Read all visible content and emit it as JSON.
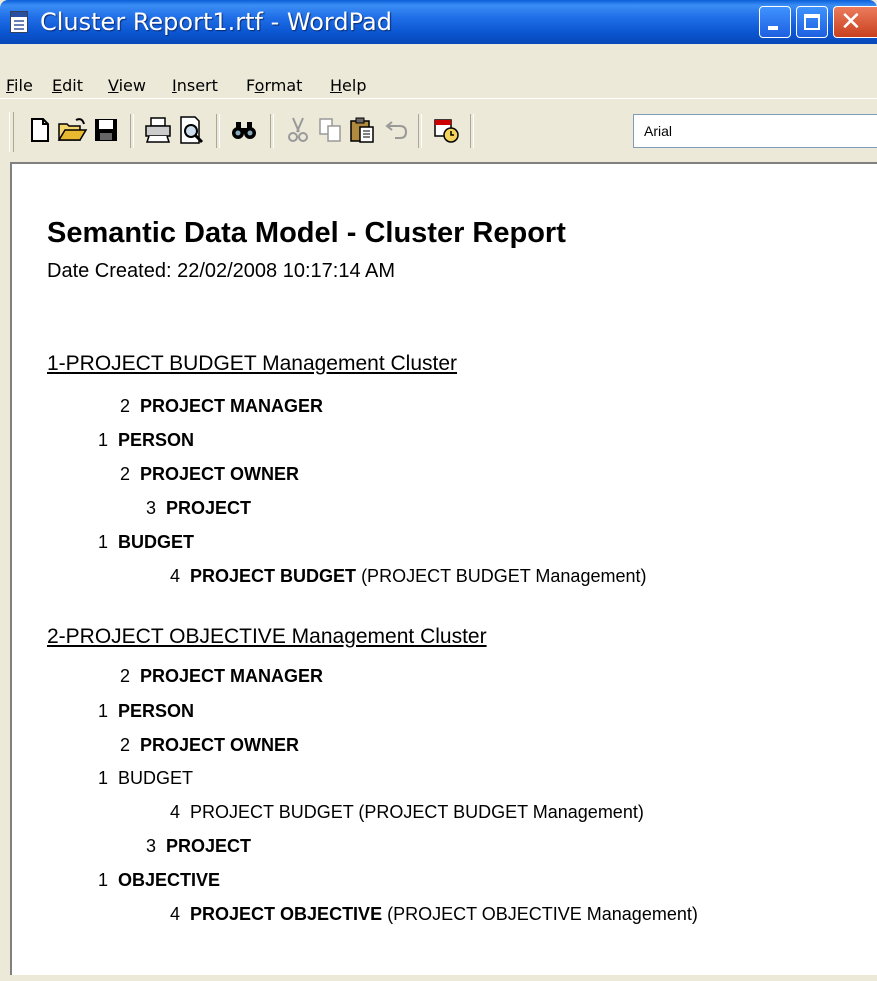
{
  "window": {
    "title": "Cluster Report1.rtf - WordPad"
  },
  "menu": [
    {
      "label": "File",
      "accel": "F",
      "rest": "ile"
    },
    {
      "label": "Edit",
      "accel": "E",
      "rest": "dit"
    },
    {
      "label": "View",
      "accel": "V",
      "rest": "iew"
    },
    {
      "label": "Insert",
      "accel": "I",
      "rest": "nsert"
    },
    {
      "label": "Format",
      "pre": "F",
      "accel": "o",
      "rest": "rmat"
    },
    {
      "label": "Help",
      "accel": "H",
      "rest": "elp"
    }
  ],
  "toolbar": {
    "buttons": [
      "new-icon",
      "open-icon",
      "save-icon",
      "print-icon",
      "print-preview-icon",
      "find-icon",
      "cut-icon",
      "copy-icon",
      "paste-icon",
      "undo-icon",
      "insert-datetime-icon"
    ],
    "font_name": "Arial"
  },
  "document": {
    "heading": "Semantic Data Model - Cluster Report",
    "date_created": "Date Created: 22/02/2008 10:17:14 AM",
    "clusters": [
      {
        "title": "1-PROJECT BUDGET Management Cluster",
        "lines": [
          {
            "num": "2",
            "name": "PROJECT MANAGER",
            "bold": true,
            "suffix": ""
          },
          {
            "num": "1",
            "name": "PERSON",
            "bold": true,
            "suffix": ""
          },
          {
            "num": "2",
            "name": "PROJECT OWNER",
            "bold": true,
            "suffix": ""
          },
          {
            "num": "3",
            "name": "PROJECT",
            "bold": true,
            "suffix": ""
          },
          {
            "num": "1",
            "name": "BUDGET",
            "bold": true,
            "suffix": ""
          },
          {
            "num": "4",
            "name": "PROJECT BUDGET",
            "bold": true,
            "suffix": " (PROJECT BUDGET Management)"
          }
        ]
      },
      {
        "title": "2-PROJECT OBJECTIVE Management Cluster",
        "lines": [
          {
            "num": "2",
            "name": "PROJECT MANAGER",
            "bold": true,
            "suffix": ""
          },
          {
            "num": "1",
            "name": "PERSON",
            "bold": true,
            "suffix": ""
          },
          {
            "num": "2",
            "name": "PROJECT OWNER",
            "bold": true,
            "suffix": ""
          },
          {
            "num": "1",
            "name": "BUDGET",
            "bold": false,
            "suffix": ""
          },
          {
            "num": "4",
            "name": "PROJECT BUDGET",
            "bold": false,
            "suffix": " (PROJECT BUDGET Management)"
          },
          {
            "num": "3",
            "name": "PROJECT",
            "bold": true,
            "suffix": ""
          },
          {
            "num": "1",
            "name": "OBJECTIVE",
            "bold": true,
            "suffix": ""
          },
          {
            "num": "4",
            "name": "PROJECT OBJECTIVE",
            "bold": true,
            "suffix": " (PROJECT OBJECTIVE Management)"
          }
        ]
      }
    ]
  }
}
